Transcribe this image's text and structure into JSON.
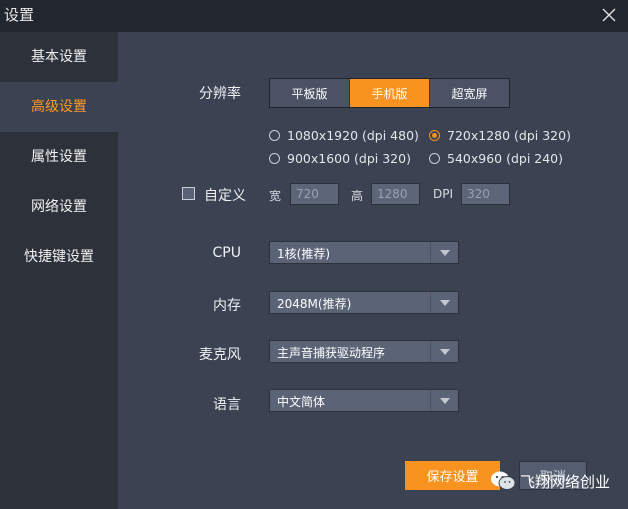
{
  "window": {
    "title": "设置"
  },
  "sidebar": {
    "items": [
      {
        "label": "基本设置"
      },
      {
        "label": "高级设置"
      },
      {
        "label": "属性设置"
      },
      {
        "label": "网络设置"
      },
      {
        "label": "快捷键设置"
      }
    ],
    "active_index": 1
  },
  "resolution": {
    "label": "分辨率",
    "modes": [
      "平板版",
      "手机版",
      "超宽屏"
    ],
    "selected_mode": "手机版",
    "options": [
      {
        "label": "1080x1920 (dpi 480)",
        "checked": false
      },
      {
        "label": "720x1280 (dpi 320)",
        "checked": true
      },
      {
        "label": "900x1600 (dpi 320)",
        "checked": false
      },
      {
        "label": "540x960 (dpi 240)",
        "checked": false
      }
    ]
  },
  "custom": {
    "label": "自定义",
    "checked": false,
    "width_label": "宽",
    "width_value": "720",
    "height_label": "高",
    "height_value": "1280",
    "dpi_label": "DPI",
    "dpi_value": "320"
  },
  "cpu": {
    "label": "CPU",
    "value": "1核(推荐)"
  },
  "memory": {
    "label": "内存",
    "value": "2048M(推荐)"
  },
  "microphone": {
    "label": "麦克风",
    "value": "主声音捕获驱动程序"
  },
  "language": {
    "label": "语言",
    "value": "中文简体"
  },
  "buttons": {
    "save": "保存设置",
    "cancel": "取消"
  },
  "watermark": {
    "text": "飞翔网络创业"
  },
  "colors": {
    "accent": "#f7931e",
    "sidebar": "#2c313a",
    "panel": "#3b4252",
    "titlebar": "#22262e"
  }
}
